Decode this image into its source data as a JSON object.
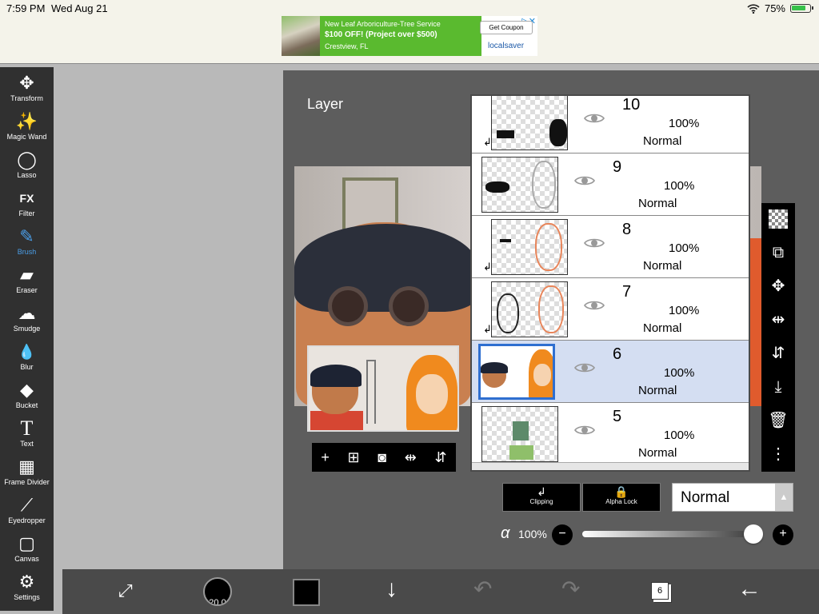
{
  "status_bar": {
    "time": "7:59 PM",
    "date": "Wed Aug 21",
    "battery": "75%"
  },
  "ad": {
    "line1": "New Leaf Arboriculture-Tree Service",
    "line2": "$100 OFF! (Project over $500)",
    "line3": "Crestview, FL",
    "cta": "Get Coupon",
    "brand": "localsaver"
  },
  "toolbar": [
    {
      "label": "Transform",
      "icon": "✥"
    },
    {
      "label": "Magic Wand",
      "icon": "✨"
    },
    {
      "label": "Lasso",
      "icon": "◯"
    },
    {
      "label": "Filter",
      "icon": "FX"
    },
    {
      "label": "Brush",
      "icon": "✎",
      "active": true
    },
    {
      "label": "Eraser",
      "icon": "▰"
    },
    {
      "label": "Smudge",
      "icon": "☁"
    },
    {
      "label": "Blur",
      "icon": "💧"
    },
    {
      "label": "Bucket",
      "icon": "◆"
    },
    {
      "label": "Text",
      "icon": "T"
    },
    {
      "label": "Frame Divider",
      "icon": "▦"
    },
    {
      "label": "Eyedropper",
      "icon": "⟋"
    },
    {
      "label": "Canvas",
      "icon": "▢"
    },
    {
      "label": "Settings",
      "icon": "⚙"
    }
  ],
  "panel": {
    "title": "Layer"
  },
  "layers": [
    {
      "num": "10",
      "opacity": "100%",
      "mode": "Normal",
      "clipped": true,
      "selected": false
    },
    {
      "num": "9",
      "opacity": "100%",
      "mode": "Normal",
      "clipped": false,
      "selected": false
    },
    {
      "num": "8",
      "opacity": "100%",
      "mode": "Normal",
      "clipped": true,
      "selected": false
    },
    {
      "num": "7",
      "opacity": "100%",
      "mode": "Normal",
      "clipped": true,
      "selected": false
    },
    {
      "num": "6",
      "opacity": "100%",
      "mode": "Normal",
      "clipped": false,
      "selected": true
    },
    {
      "num": "5",
      "opacity": "100%",
      "mode": "Normal",
      "clipped": false,
      "selected": false
    }
  ],
  "layer_controls": {
    "clipping_label": "Clipping",
    "alpha_lock_label": "Alpha Lock",
    "blend_mode": "Normal",
    "alpha_symbol": "α",
    "opacity_label": "100%",
    "opacity_fraction": 1.0
  },
  "bottom_bar": {
    "brush_size": "20.0",
    "layer_count": "6"
  },
  "colors": {
    "selected_layer": "#d4def2",
    "accent": "#4a9ee8",
    "foreground_color": "#000000"
  }
}
